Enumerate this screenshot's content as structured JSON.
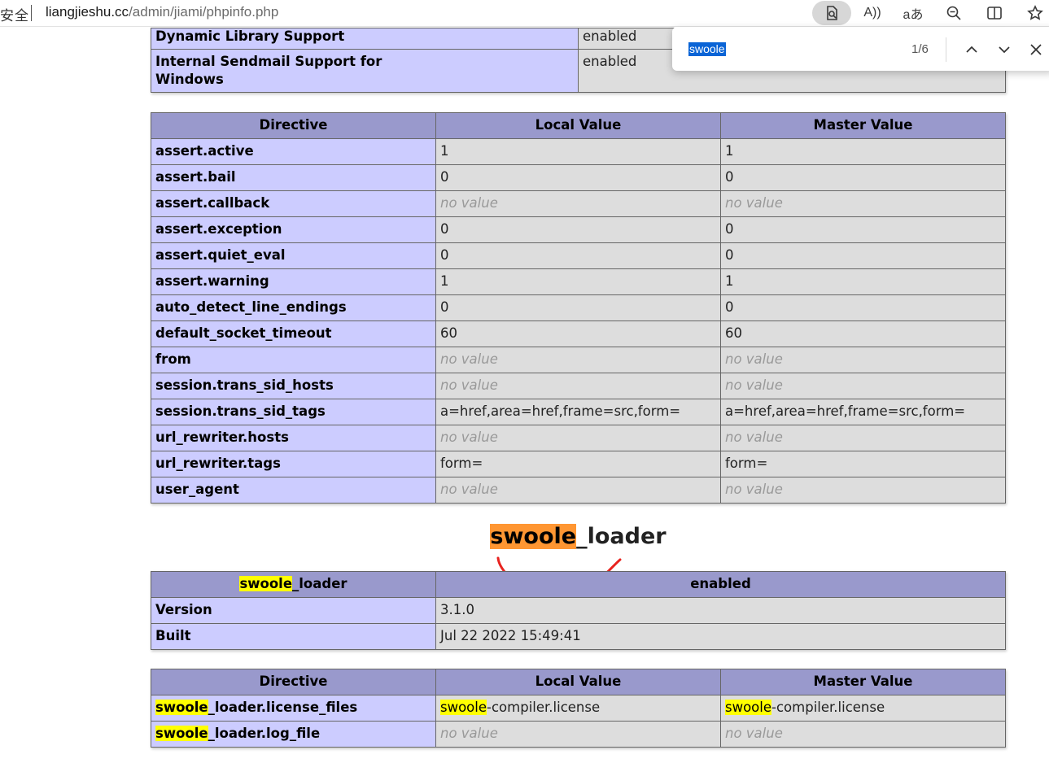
{
  "browser": {
    "security_text": "安全",
    "url_host": "liangjieshu.cc",
    "url_path": "/admin/jiami/phpinfo.php",
    "toolbar": {
      "find_icon": "find-on-page-icon",
      "read_aloud_icon": "read-aloud-icon",
      "read_aloud_label": "A",
      "translate_icon": "translate-icon",
      "translate_label": "aあ",
      "zoom_icon": "zoom-out-icon",
      "split_icon": "split-screen-icon",
      "favorite_icon": "star-icon"
    }
  },
  "find_bar": {
    "query": "swoole",
    "count": "1/6"
  },
  "top_table": {
    "rows": [
      {
        "name": "Dynamic Library Support",
        "value": "enabled"
      },
      {
        "name_line1": "Internal Sendmail Support for",
        "name_line2": "Windows",
        "value": "enabled"
      }
    ]
  },
  "assert_table": {
    "headers": [
      "Directive",
      "Local Value",
      "Master Value"
    ],
    "rows": [
      {
        "directive": "assert.active",
        "local": "1",
        "master": "1"
      },
      {
        "directive": "assert.bail",
        "local": "0",
        "master": "0"
      },
      {
        "directive": "assert.callback",
        "local": "no value",
        "master": "no value"
      },
      {
        "directive": "assert.exception",
        "local": "0",
        "master": "0"
      },
      {
        "directive": "assert.quiet_eval",
        "local": "0",
        "master": "0"
      },
      {
        "directive": "assert.warning",
        "local": "1",
        "master": "1"
      },
      {
        "directive": "auto_detect_line_endings",
        "local": "0",
        "master": "0"
      },
      {
        "directive": "default_socket_timeout",
        "local": "60",
        "master": "60"
      },
      {
        "directive": "from",
        "local": "no value",
        "master": "no value"
      },
      {
        "directive": "session.trans_sid_hosts",
        "local": "no value",
        "master": "no value"
      },
      {
        "directive": "session.trans_sid_tags",
        "local": "a=href,area=href,frame=src,form=",
        "master": "a=href,area=href,frame=src,form="
      },
      {
        "directive": "url_rewriter.hosts",
        "local": "no value",
        "master": "no value"
      },
      {
        "directive": "url_rewriter.tags",
        "local": "form=",
        "master": "form="
      },
      {
        "directive": "user_agent",
        "local": "no value",
        "master": "no value"
      }
    ]
  },
  "module": {
    "heading_match": "swoole",
    "heading_rest": "_loader",
    "info_table": {
      "header_match": "swoole",
      "header_rest": "_loader",
      "header_value": "enabled",
      "rows": [
        {
          "name": "Version",
          "value": "3.1.0"
        },
        {
          "name": "Built",
          "value": "Jul 22 2022 15:49:41"
        }
      ]
    },
    "directive_table": {
      "headers": [
        "Directive",
        "Local Value",
        "Master Value"
      ],
      "rows": [
        {
          "directive_match": "swoole",
          "directive_rest": "_loader.license_files",
          "local_match": "swoole",
          "local_rest": "-compiler.license",
          "master_match": "swoole",
          "master_rest": "-compiler.license"
        },
        {
          "directive_match": "swoole",
          "directive_rest": "_loader.log_file",
          "local": "no value",
          "master": "no value"
        }
      ]
    }
  },
  "colors": {
    "header_bg": "#9999cc",
    "key_bg": "#ccccff",
    "value_bg": "#dddddd",
    "find_highlight": "#ffff00",
    "current_match": "#ff9632",
    "annotation_stroke": "#e8231f"
  }
}
